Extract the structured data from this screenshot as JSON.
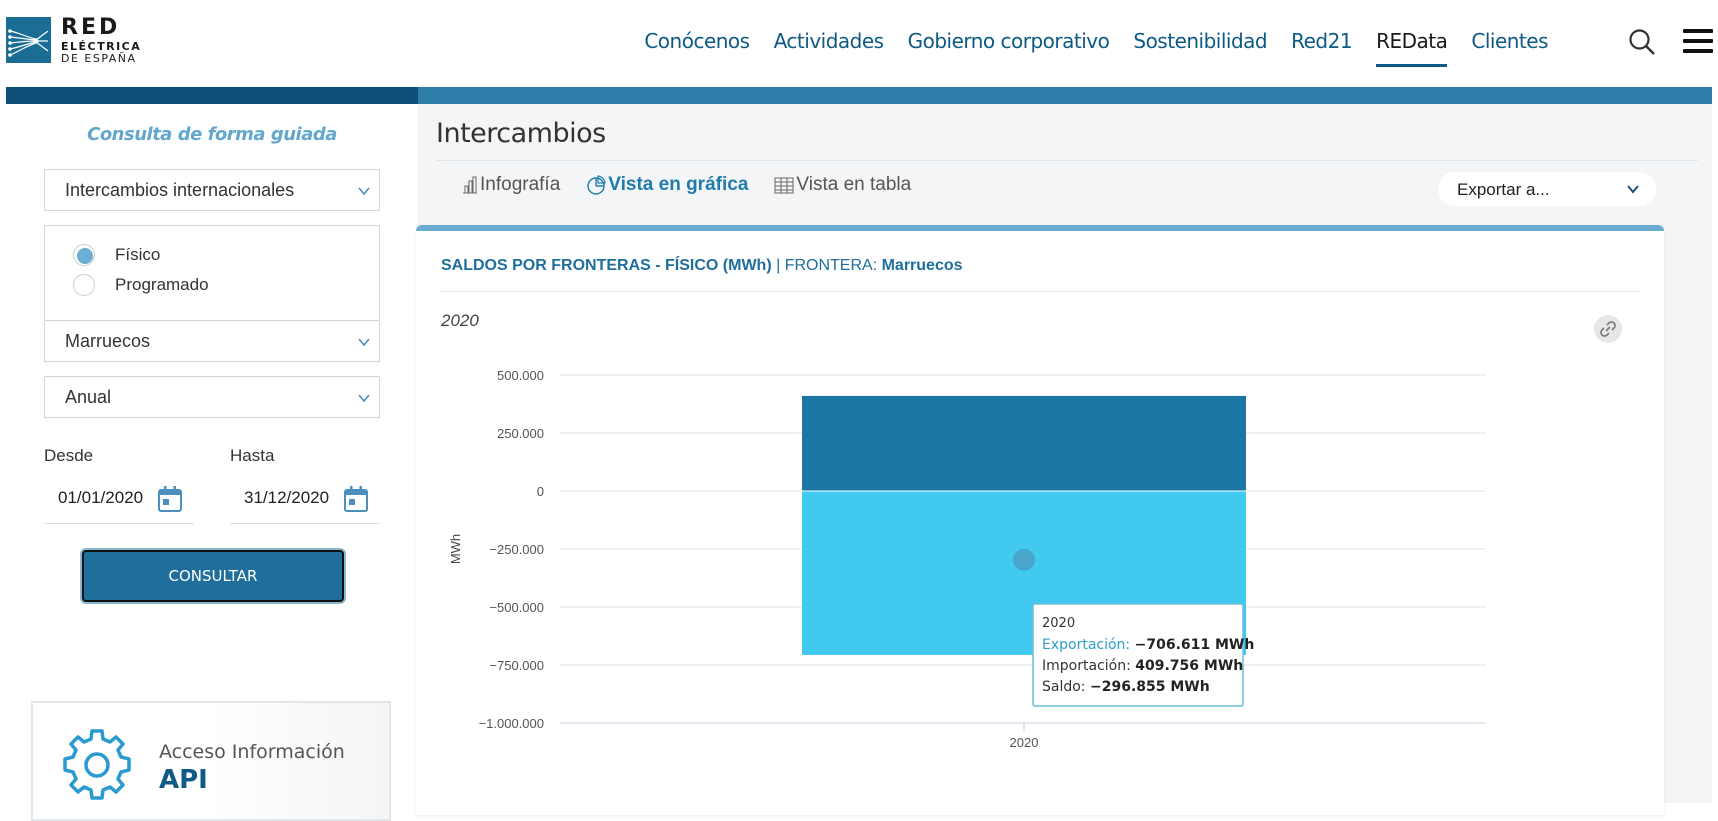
{
  "header": {
    "logo": {
      "line1": "RED",
      "line2": "ELÉCTRICA",
      "line3": "DE ESPAÑA"
    },
    "nav": [
      {
        "label": "Conócenos",
        "active": false
      },
      {
        "label": "Actividades",
        "active": false
      },
      {
        "label": "Gobierno corporativo",
        "active": false
      },
      {
        "label": "Sostenibilidad",
        "active": false
      },
      {
        "label": "Red21",
        "active": false
      },
      {
        "label": "REData",
        "active": true
      },
      {
        "label": "Clientes",
        "active": false
      }
    ],
    "icons": {
      "search": "search-icon",
      "menu": "hamburger-menu-icon"
    }
  },
  "sidebar": {
    "title": "Consulta de forma guiada",
    "category_select": "Intercambios internacionales",
    "radio_options": [
      {
        "label": "Físico",
        "checked": true
      },
      {
        "label": "Programado",
        "checked": false
      }
    ],
    "frontier_select": "Marruecos",
    "period_select": "Anual",
    "from_label": "Desde",
    "from_value": "01/01/2020",
    "to_label": "Hasta",
    "to_value": "31/12/2020",
    "consult_button": "CONSULTAR",
    "api_card": {
      "line1": "Acceso Información",
      "line2": "API"
    }
  },
  "main": {
    "title": "Intercambios",
    "tabs": [
      {
        "label": "Infografía",
        "active": false,
        "icon": "bar-chart-icon"
      },
      {
        "label": "Vista en gráfica",
        "active": true,
        "icon": "pie-chart-icon"
      },
      {
        "label": "Vista en tabla",
        "active": false,
        "icon": "table-icon"
      }
    ],
    "export_select": "Exportar a...",
    "chart_header": {
      "title": "SALDOS POR FRONTERAS - FÍSICO (MWh)",
      "separator": " | ",
      "frontier_label": "FRONTERA: ",
      "frontier_value": "Marruecos"
    },
    "year_label": "2020"
  },
  "colors": {
    "export_bar": "#42c9f0",
    "import_bar": "#1a77a3",
    "accent": "#1f6e9b"
  },
  "chart_data": {
    "type": "bar",
    "stacked": true,
    "categories": [
      "2020"
    ],
    "series": [
      {
        "name": "Exportación",
        "values": [
          -706611
        ]
      },
      {
        "name": "Importación",
        "values": [
          409756
        ]
      },
      {
        "name": "Saldo",
        "values": [
          -296855
        ]
      }
    ],
    "ylabel": "MWh",
    "yticks": [
      "500.000",
      "250.000",
      "0",
      "−250.000",
      "−500.000",
      "−750.000",
      "−1.000.000"
    ],
    "ylim": [
      -1000000,
      500000
    ],
    "grid": true,
    "tooltip": {
      "title": "2020",
      "rows": [
        {
          "label": "Exportación",
          "value": "−706.611 MWh"
        },
        {
          "label": "Importación",
          "value": "409.756 MWh"
        },
        {
          "label": "Saldo",
          "value": "−296.855 MWh"
        }
      ]
    }
  }
}
